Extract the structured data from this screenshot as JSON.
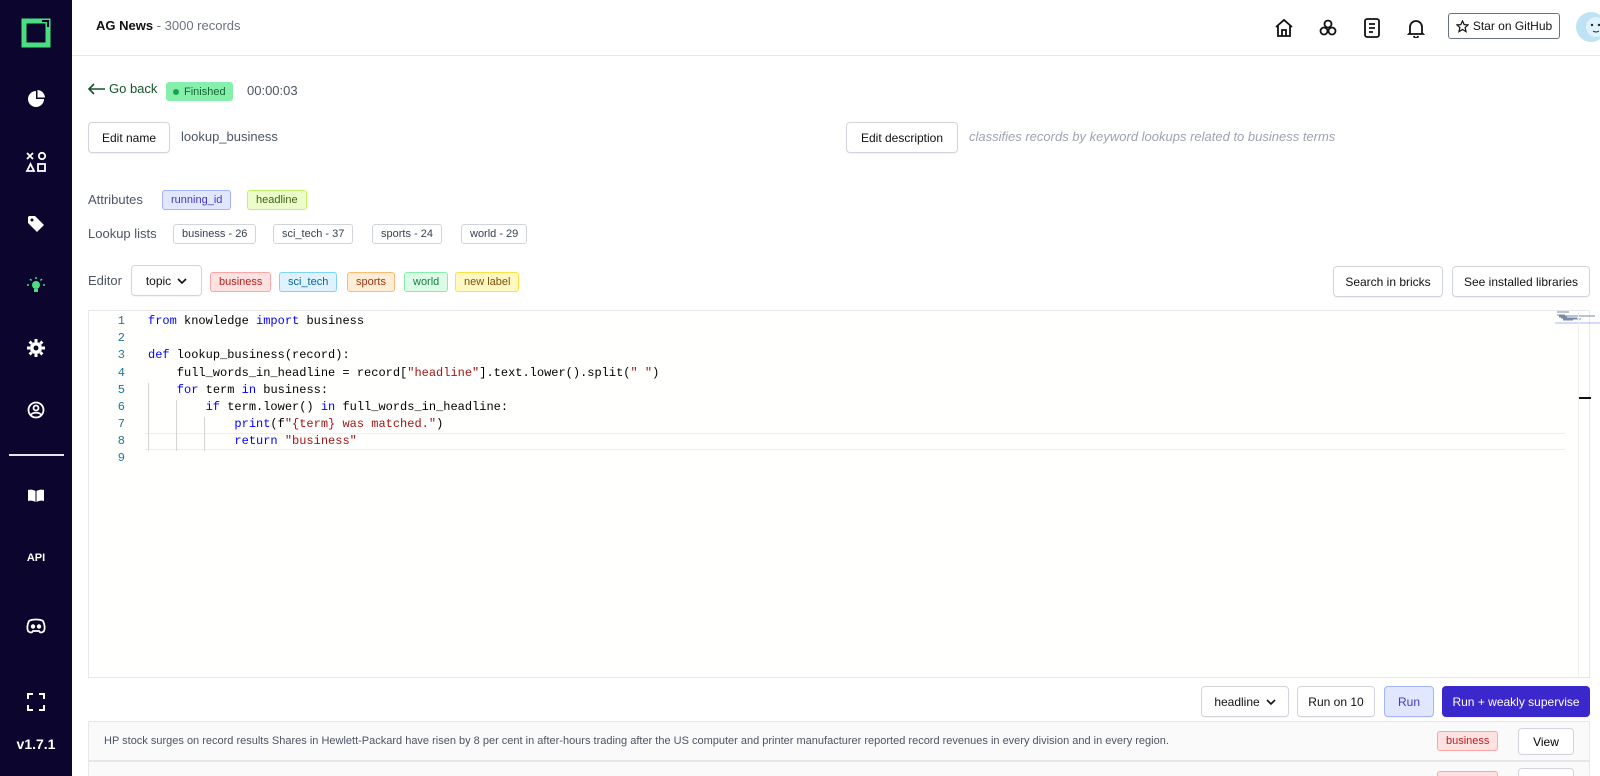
{
  "app": {
    "version": "v1.7.1",
    "project_name": "AG News",
    "project_separator": " - ",
    "record_count": "3000 records",
    "star_github_label": "Star on GitHub",
    "brand_color": "#0c052e",
    "accent_color": "#3b28cc"
  },
  "sidebar": {
    "items": [
      {
        "name": "overview",
        "icon": "pie-chart-icon"
      },
      {
        "name": "data-browser",
        "icon": "shapes-icon"
      },
      {
        "name": "labeling",
        "icon": "tag-icon"
      },
      {
        "name": "heuristics",
        "icon": "bulb-icon",
        "active": true
      },
      {
        "name": "settings",
        "icon": "gear-icon"
      },
      {
        "name": "users",
        "icon": "user-circle-icon"
      },
      {
        "name": "docs",
        "icon": "book-icon"
      },
      {
        "name": "api",
        "label": "API"
      },
      {
        "name": "discord",
        "icon": "discord-icon"
      },
      {
        "name": "fullscreen",
        "icon": "expand-icon"
      }
    ]
  },
  "page": {
    "go_back": "Go back",
    "status": "Finished",
    "duration": "00:00:03",
    "edit_name_label": "Edit name",
    "function_name": "lookup_business",
    "edit_description_label": "Edit description",
    "description": "classifies records by keyword lookups related to business terms",
    "attributes_label": "Attributes",
    "attributes": [
      "running_id",
      "headline"
    ],
    "lookup_label": "Lookup lists",
    "lookup_lists": [
      "business - 26",
      "sci_tech - 37",
      "sports - 24",
      "world - 29"
    ],
    "editor_label": "Editor",
    "task_select": "topic",
    "labels": [
      "business",
      "sci_tech",
      "sports",
      "world",
      "new label"
    ],
    "search_bricks": "Search in bricks",
    "installed_libs": "See installed libraries"
  },
  "code": {
    "line_numbers": [
      "1",
      "2",
      "3",
      "4",
      "5",
      "6",
      "7",
      "8",
      "9"
    ],
    "tokens": {
      "l1_from": "from",
      "l1_mid": " knowledge ",
      "l1_import": "import",
      "l1_end": " business",
      "l3_def": "def",
      "l3_end": " lookup_business(record):",
      "l4_a": "    full_words_in_headline = record[",
      "l4_str": "\"headline\"",
      "l4_b": "].text.lower().split(",
      "l4_str2": "\" \"",
      "l4_c": ")",
      "l5_for": "    for",
      "l5_mid": " term ",
      "l5_in": "in",
      "l5_end": " business:",
      "l6_if": "        if",
      "l6_mid": " term.lower() ",
      "l6_in": "in",
      "l6_end": " full_words_in_headline:",
      "l7_print": "            print",
      "l7_a": "(f",
      "l7_str": "\"{term} was matched.\"",
      "l7_b": ")",
      "l8_return": "            return ",
      "l8_str": "\"business\""
    }
  },
  "actions": {
    "attribute_select": "headline",
    "run_on_10": "Run on 10",
    "run": "Run",
    "run_supervise": "Run + weakly supervise"
  },
  "results": [
    {
      "text": "HP stock surges on record results Shares in Hewlett-Packard have risen by 8 per cent in after-hours trading after the US computer and printer manufacturer reported record revenues in every division and in every region.",
      "label": "business",
      "view": "View"
    },
    {
      "text": "",
      "label": "business",
      "view": "View"
    }
  ]
}
